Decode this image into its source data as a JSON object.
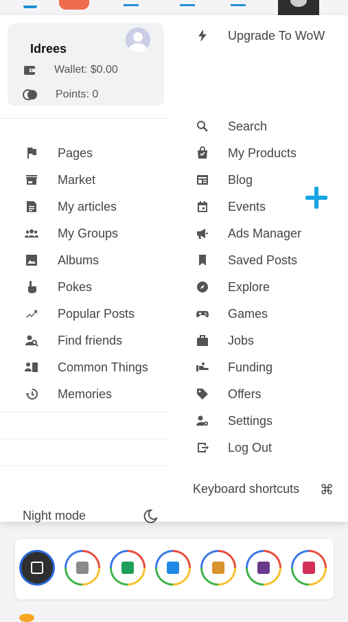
{
  "user": {
    "name": "Idrees",
    "wallet": "Wallet: $0.00",
    "points": "Points: 0"
  },
  "upgrade": "Upgrade To WoW",
  "left_menu": [
    {
      "label": "Pages",
      "icon": "flag-icon"
    },
    {
      "label": "Market",
      "icon": "store-icon"
    },
    {
      "label": "My articles",
      "icon": "article-icon"
    },
    {
      "label": "My Groups",
      "icon": "groups-icon"
    },
    {
      "label": "Albums",
      "icon": "image-icon"
    },
    {
      "label": "Pokes",
      "icon": "poke-hand-icon"
    },
    {
      "label": "Popular Posts",
      "icon": "trending-icon"
    },
    {
      "label": "Find friends",
      "icon": "find-person-icon"
    },
    {
      "label": "Common Things",
      "icon": "common-things-icon"
    },
    {
      "label": "Memories",
      "icon": "history-icon"
    }
  ],
  "right_menu": [
    {
      "label": "Search",
      "icon": "search-icon"
    },
    {
      "label": "My Products",
      "icon": "shopping-bag-icon"
    },
    {
      "label": "Blog",
      "icon": "blog-icon"
    },
    {
      "label": "Events",
      "icon": "calendar-icon"
    },
    {
      "label": "Ads Manager",
      "icon": "megaphone-icon"
    },
    {
      "label": "Saved Posts",
      "icon": "bookmark-icon"
    },
    {
      "label": "Explore",
      "icon": "compass-icon"
    },
    {
      "label": "Games",
      "icon": "gamepad-icon"
    },
    {
      "label": "Jobs",
      "icon": "briefcase-icon"
    },
    {
      "label": "Funding",
      "icon": "funding-icon"
    },
    {
      "label": "Offers",
      "icon": "tag-icon"
    },
    {
      "label": "Settings",
      "icon": "user-settings-icon"
    },
    {
      "label": "Log Out",
      "icon": "logout-icon"
    }
  ],
  "keyboard_shortcuts": "Keyboard shortcuts",
  "night_mode": "Night mode",
  "apps": [
    {
      "name": "app-1",
      "color": "#2f2f2f"
    },
    {
      "name": "app-2",
      "color": "#8a8a8a"
    },
    {
      "name": "app-3",
      "color": "#21a05a"
    },
    {
      "name": "app-4",
      "color": "#1e88e5"
    },
    {
      "name": "app-5",
      "color": "#d9932c"
    },
    {
      "name": "app-6",
      "color": "#6a3a8c"
    },
    {
      "name": "app-7",
      "color": "#d32f5a"
    }
  ],
  "accent": "#17a4e0"
}
